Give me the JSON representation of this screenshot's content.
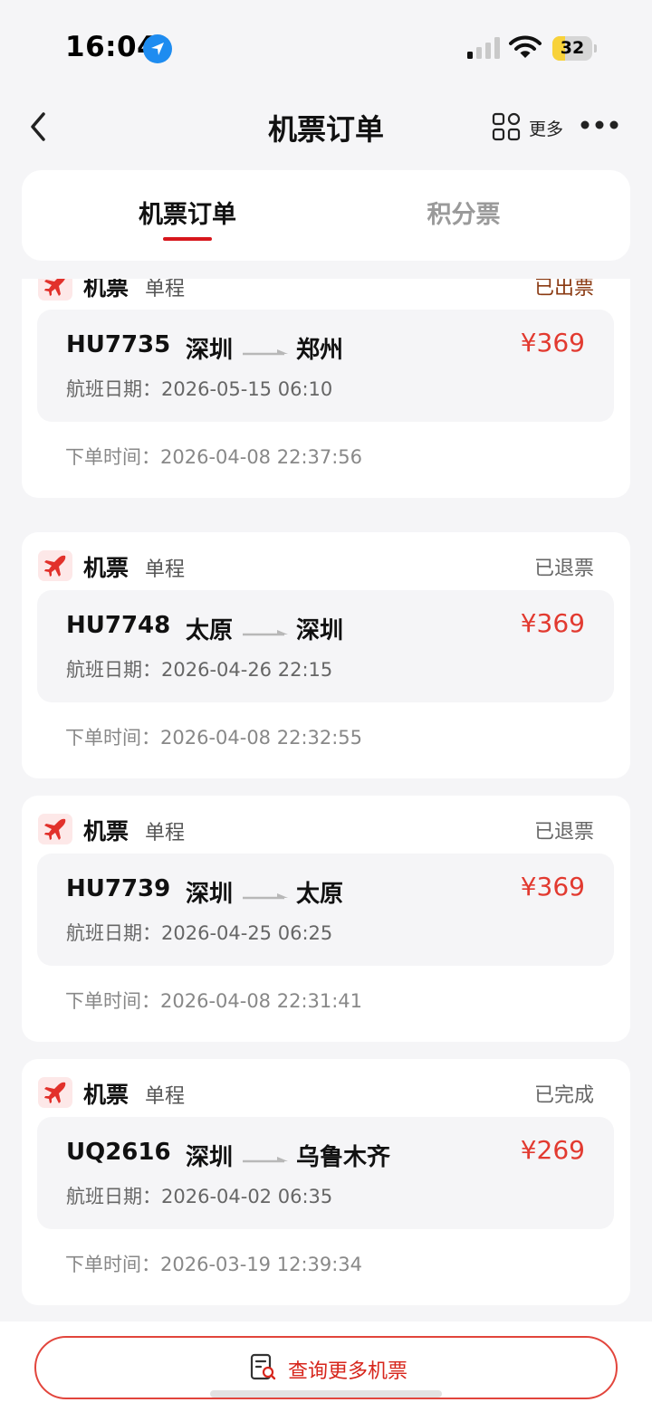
{
  "status_bar": {
    "time": "16:04",
    "battery": "32",
    "battery_fraction": 0.32,
    "icons": [
      "location-arrow-icon",
      "signal-bars-icon",
      "wifi-icon",
      "battery-icon"
    ]
  },
  "nav": {
    "title": "机票订单",
    "more_label": "更多",
    "icons": [
      "back-chevron-icon",
      "grid-more-icon",
      "ellipsis-icon"
    ]
  },
  "tabs": [
    {
      "label": "机票订单",
      "active": true
    },
    {
      "label": "积分票",
      "active": false
    }
  ],
  "colors": {
    "accent_red": "#d7161c",
    "price_red": "#e23a30",
    "status_issued": "#8a3a12",
    "background": "#f5f5f7"
  },
  "orders": [
    {
      "type": "机票",
      "trip": "单程",
      "status": "已出票",
      "flight_no": "HU7735",
      "from": "深圳",
      "to": "郑州",
      "price": "¥369",
      "flight_date": "航班日期：2026-05-15 06:10",
      "order_time": "下单时间：2026-04-08 22:37:56"
    },
    {
      "type": "机票",
      "trip": "单程",
      "status": "已退票",
      "flight_no": "HU7748",
      "from": "太原",
      "to": "深圳",
      "price": "¥369",
      "flight_date": "航班日期：2026-04-26 22:15",
      "order_time": "下单时间：2026-04-08 22:32:55"
    },
    {
      "type": "机票",
      "trip": "单程",
      "status": "已退票",
      "flight_no": "HU7739",
      "from": "深圳",
      "to": "太原",
      "price": "¥369",
      "flight_date": "航班日期：2026-04-25 06:25",
      "order_time": "下单时间：2026-04-08 22:31:41"
    },
    {
      "type": "机票",
      "trip": "单程",
      "status": "已完成",
      "flight_no": "UQ2616",
      "from": "深圳",
      "to": "乌鲁木齐",
      "price": "¥269",
      "flight_date": "航班日期：2026-04-02 06:35",
      "order_time": "下单时间：2026-03-19 12:39:34"
    }
  ],
  "bottom": {
    "query_label": "查询更多机票",
    "icon": "search-document-icon"
  }
}
